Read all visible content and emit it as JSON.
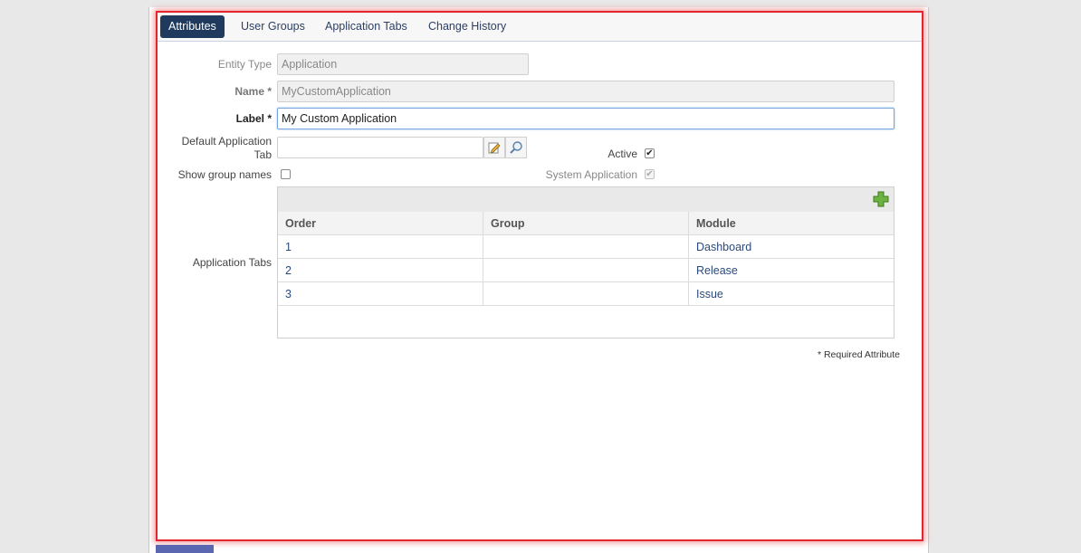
{
  "tabs": [
    {
      "label": "Attributes",
      "active": true
    },
    {
      "label": "User Groups",
      "active": false
    },
    {
      "label": "Application Tabs",
      "active": false
    },
    {
      "label": "Change History",
      "active": false
    }
  ],
  "form": {
    "entity_type": {
      "label": "Entity Type",
      "value": "Application"
    },
    "name": {
      "label": "Name *",
      "value": "MyCustomApplication"
    },
    "label_field": {
      "label": "Label *",
      "value": "My Custom Application"
    },
    "default_tab": {
      "label_line1": "Default Application",
      "label_line2": "Tab",
      "value": ""
    },
    "active": {
      "label": "Active",
      "checked": true
    },
    "show_group_names": {
      "label": "Show group names",
      "checked": false
    },
    "system_application": {
      "label": "System Application",
      "checked": true
    },
    "application_tabs_label": "Application Tabs"
  },
  "grid": {
    "columns": [
      "Order",
      "Group",
      "Module"
    ],
    "rows": [
      {
        "order": "1",
        "group": "",
        "module": "Dashboard"
      },
      {
        "order": "2",
        "group": "",
        "module": "Release"
      },
      {
        "order": "3",
        "group": "",
        "module": "Issue"
      }
    ]
  },
  "required_note": "* Required Attribute",
  "colors": {
    "accent_border": "#e3262d",
    "active_tab": "#1f3a5c",
    "add_icon": "#5aa02c"
  }
}
